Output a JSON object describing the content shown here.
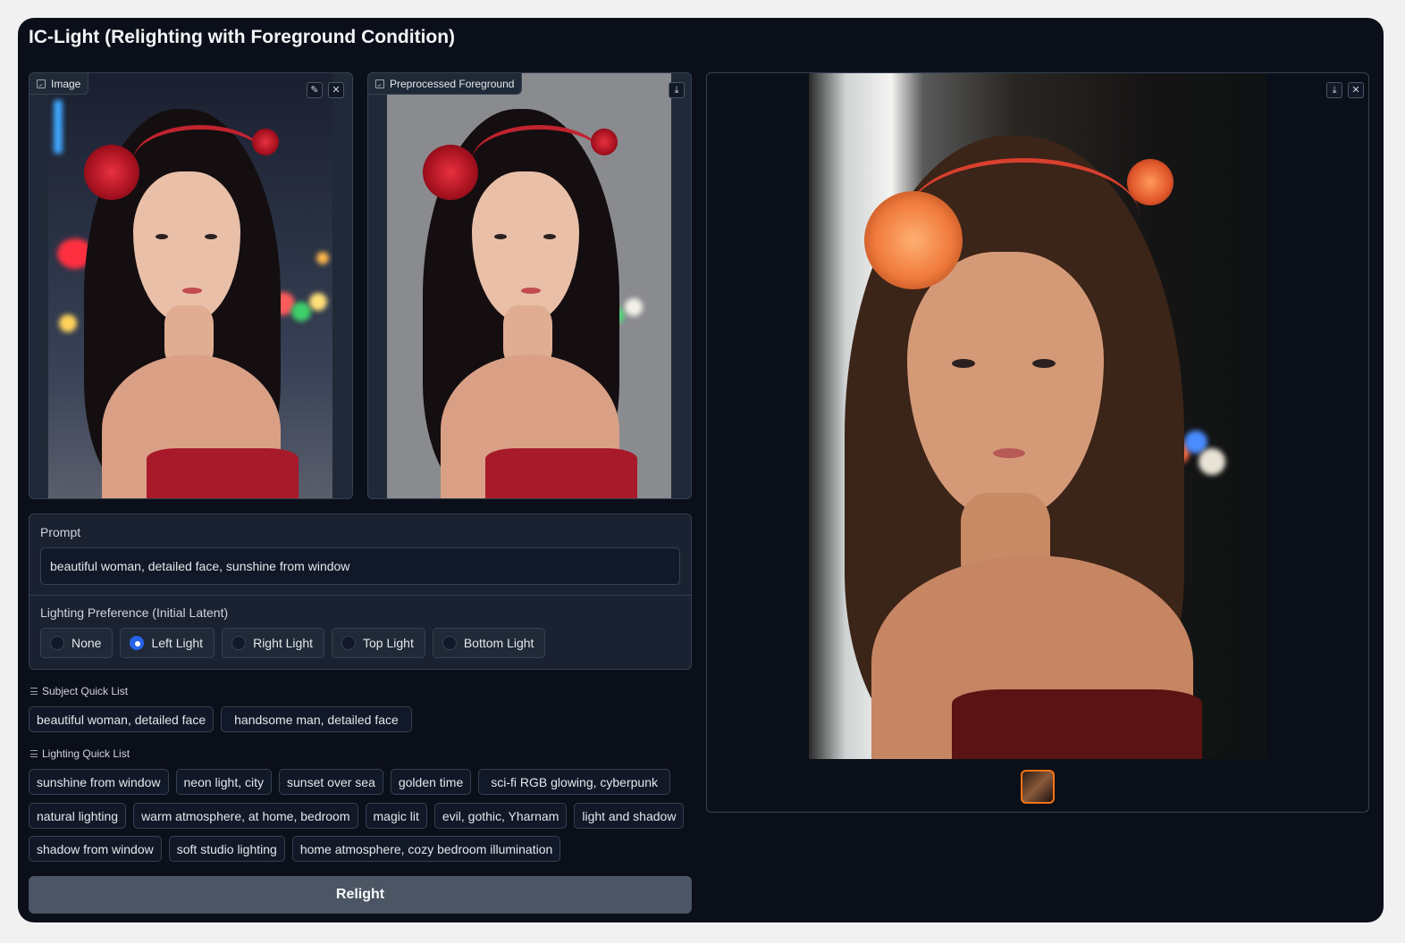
{
  "app": {
    "title": "IC-Light (Relighting with Foreground Condition)"
  },
  "input_image": {
    "label": "Image",
    "edit_icon": "pencil-icon",
    "close_icon": "close-icon"
  },
  "preprocessed": {
    "label": "Preprocessed Foreground",
    "download_icon": "download-icon"
  },
  "prompt": {
    "label": "Prompt",
    "value": "beautiful woman, detailed face, sunshine from window"
  },
  "lighting_preference": {
    "label": "Lighting Preference (Initial Latent)",
    "options": [
      "None",
      "Left Light",
      "Right Light",
      "Top Light",
      "Bottom Light"
    ],
    "selected": "Left Light"
  },
  "subject_quick_list": {
    "label": "Subject Quick List",
    "items": [
      "beautiful woman, detailed face",
      "handsome man, detailed face"
    ]
  },
  "lighting_quick_list": {
    "label": "Lighting Quick List",
    "rows": [
      [
        "sunshine from window",
        "neon light, city",
        "sunset over sea",
        "golden time",
        "sci-fi RGB glowing, cyberpunk"
      ],
      [
        "natural lighting",
        "warm atmosphere, at home, bedroom",
        "magic lit",
        "evil, gothic, Yharnam",
        "light and shadow"
      ],
      [
        "shadow from window",
        "soft studio lighting",
        "home atmosphere, cozy bedroom illumination"
      ]
    ]
  },
  "relight_button": "Relight",
  "gallery": {
    "download_icon": "download-icon",
    "close_icon": "close-icon",
    "accent": "#f97316"
  }
}
